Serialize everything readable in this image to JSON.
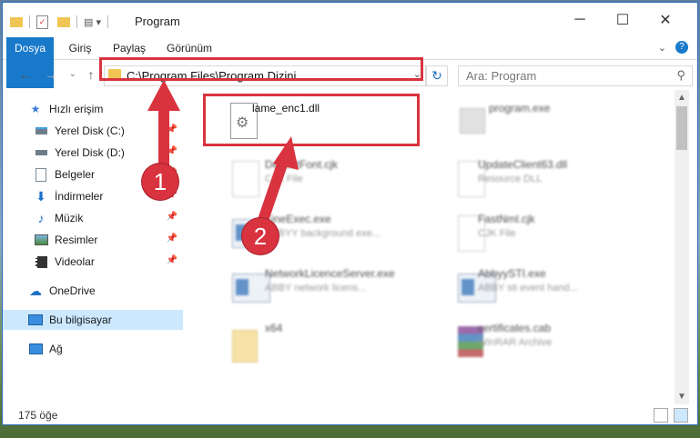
{
  "window": {
    "title": "Program",
    "controls": {
      "minimize": "─",
      "maximize": "☐",
      "close": "✕"
    }
  },
  "ribbon": {
    "tabs": [
      "Dosya",
      "Giriş",
      "Paylaş",
      "Görünüm"
    ]
  },
  "address": {
    "path": "C:\\Program Files\\Program Dizini",
    "search_placeholder": "Ara: Program"
  },
  "sidebar": {
    "items": [
      {
        "label": "Hızlı erişim",
        "icon": "star-icon"
      },
      {
        "label": "Yerel Disk (C:)",
        "icon": "drive-icon"
      },
      {
        "label": "Yerel Disk (D:)",
        "icon": "drive-icon"
      },
      {
        "label": "Belgeler",
        "icon": "documents-icon"
      },
      {
        "label": "İndirmeler",
        "icon": "download-icon"
      },
      {
        "label": "Müzik",
        "icon": "music-icon"
      },
      {
        "label": "Resimler",
        "icon": "pictures-icon"
      },
      {
        "label": "Videolar",
        "icon": "videos-icon"
      },
      {
        "label": "OneDrive",
        "icon": "cloud-icon"
      },
      {
        "label": "Bu bilgisayar",
        "icon": "computer-icon"
      },
      {
        "label": "Ağ",
        "icon": "network-icon"
      }
    ]
  },
  "files": [
    {
      "name": "lame_enc1.dll",
      "type": ""
    },
    {
      "name": "program.exe",
      "type": ""
    },
    {
      "name": "DefaultFont.cjk",
      "type": "CJK File"
    },
    {
      "name": "UpdateClient63.dll",
      "type": "Resource DLL"
    },
    {
      "name": "FineExec.exe",
      "type": "ABBYY background exe..."
    },
    {
      "name": "FastNml.cjk",
      "type": "CJK File"
    },
    {
      "name": "NetworkLicenceServer.exe",
      "type": "ABBY network licens..."
    },
    {
      "name": "AbbyySTI.exe",
      "type": "ABBY sti event hand..."
    },
    {
      "name": "x64",
      "type": ""
    },
    {
      "name": "certificates.cab",
      "type": "WinRAR Archive"
    }
  ],
  "status": {
    "count": "175 öğe"
  },
  "annotations": {
    "step1": "1",
    "step2": "2"
  },
  "colors": {
    "accent": "#1979ca",
    "highlight": "#d9333f"
  }
}
